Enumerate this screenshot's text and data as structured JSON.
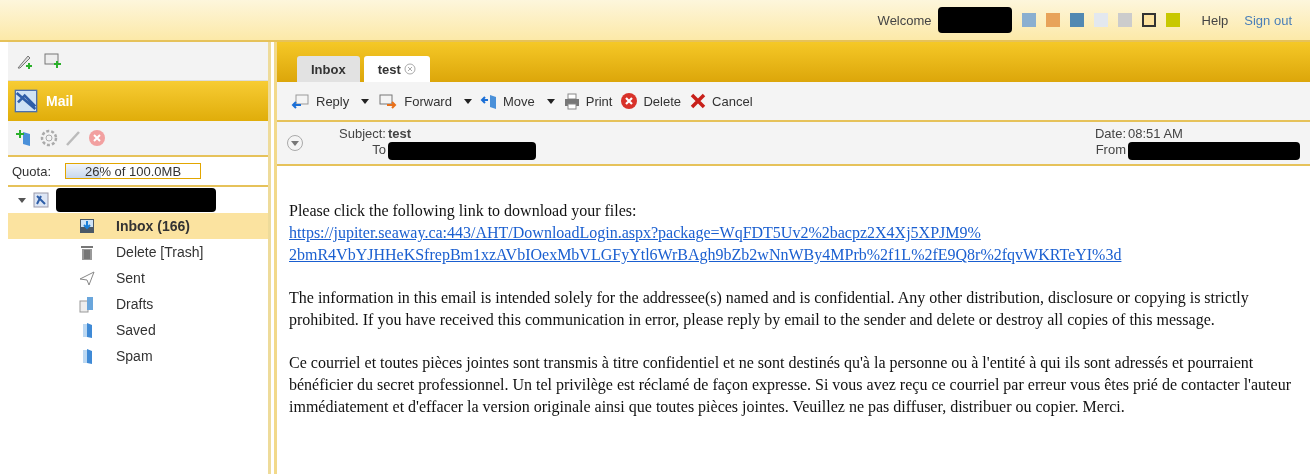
{
  "header": {
    "welcome": "Welcome",
    "swatches": [
      {
        "color": "#8aafd0",
        "selected": false
      },
      {
        "color": "#e8a35a",
        "selected": false
      },
      {
        "color": "#5289b2",
        "selected": false
      },
      {
        "color": "#e3e8ef",
        "selected": false
      },
      {
        "color": "#cccccc",
        "selected": false
      },
      {
        "color": "#fde3a0",
        "selected": true
      },
      {
        "color": "#c8c800",
        "selected": false
      }
    ],
    "links": [
      "Help",
      "Sign out"
    ]
  },
  "sidebar": {
    "section": "Mail",
    "quota": {
      "label": "Quota:",
      "text": "26% of 100.0MB",
      "level": 0.26
    },
    "folders": [
      {
        "label": "Inbox (166)",
        "kind": "inbox",
        "selected": true
      },
      {
        "label": "Delete [Trash]",
        "kind": "trash",
        "selected": false
      },
      {
        "label": "Sent",
        "kind": "sent",
        "selected": false
      },
      {
        "label": "Drafts",
        "kind": "drafts",
        "selected": false
      },
      {
        "label": "Saved",
        "kind": "folder",
        "selected": false
      },
      {
        "label": "Spam",
        "kind": "folder",
        "selected": false
      }
    ]
  },
  "tabs": [
    {
      "label": "Inbox",
      "selected": false,
      "closable": false
    },
    {
      "label": "test",
      "selected": true,
      "closable": true
    }
  ],
  "toolbar": [
    {
      "label": "Reply",
      "kind": "reply",
      "menu": true
    },
    {
      "label": "Forward",
      "kind": "forward",
      "menu": true
    },
    {
      "label": "Move",
      "kind": "move",
      "menu": true
    },
    {
      "label": "Print",
      "kind": "print",
      "menu": false
    },
    {
      "label": "Delete",
      "kind": "delete",
      "menu": false
    },
    {
      "label": "Cancel",
      "kind": "cancel",
      "menu": false
    }
  ],
  "message": {
    "subject_label": "Subject:",
    "subject": "test",
    "to_label": "To",
    "date_label": "Date:",
    "date": "08:51 AM",
    "from_label": "From",
    "intro": "Please click the following link to download your files:",
    "link_lines": [
      "https://jupiter.seaway.ca:443/AHT/DownloadLogin.aspx?package=WqFDT5Uv2%2bacpz2X4Xj5XPJM9%",
      "2bmR4VbYJHHeKSfrepBm1xzAVbIOexMbVLGFyYtl6WrBAgh9bZb2wNnWBy4MPrb%2f1L%2fE9Q8r%2fqvWKRTeYI%3d"
    ],
    "paragraphs": [
      "The information in this email is intended solely for the addressee(s) named and is confidential. Any other distribution, disclosure or copying is strictly prohibited. If you have received this communication in error, please reply by email to the sender and delete or destroy all copies of this message.",
      "Ce courriel et toutes pièces jointes sont transmis à titre confidentiel et ne sont destinés qu'à la personne ou à l'entité à qui ils sont adressés et pourraient bénéficier du secret professionnel. Un tel privilège est réclamé de façon expresse. Si vous avez reçu ce courriel par erreur vous êtes prié de contacter l'auteur immédiatement et d'effacer la version originale ainsi que toutes pièces jointes. Veuillez ne pas diffuser, distribuer ou copier. Merci."
    ]
  }
}
